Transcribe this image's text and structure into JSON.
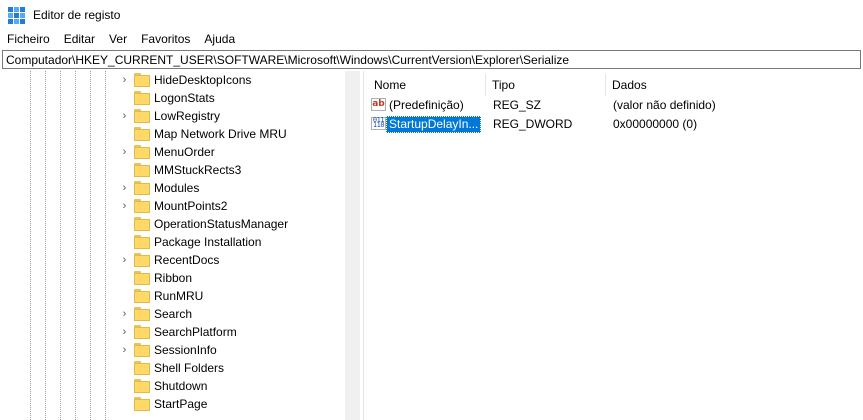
{
  "window": {
    "title": "Editor de registo"
  },
  "menubar": {
    "items": [
      "Ficheiro",
      "Editar",
      "Ver",
      "Favoritos",
      "Ajuda"
    ]
  },
  "address": {
    "path": "Computador\\HKEY_CURRENT_USER\\SOFTWARE\\Microsoft\\Windows\\CurrentVersion\\Explorer\\Serialize"
  },
  "tree": {
    "items": [
      {
        "label": "HideDesktopIcons",
        "expandable": true
      },
      {
        "label": "LogonStats",
        "expandable": false
      },
      {
        "label": "LowRegistry",
        "expandable": true
      },
      {
        "label": "Map Network Drive MRU",
        "expandable": false
      },
      {
        "label": "MenuOrder",
        "expandable": true
      },
      {
        "label": "MMStuckRects3",
        "expandable": false
      },
      {
        "label": "Modules",
        "expandable": true
      },
      {
        "label": "MountPoints2",
        "expandable": true
      },
      {
        "label": "OperationStatusManager",
        "expandable": false
      },
      {
        "label": "Package Installation",
        "expandable": false
      },
      {
        "label": "RecentDocs",
        "expandable": true
      },
      {
        "label": "Ribbon",
        "expandable": false
      },
      {
        "label": "RunMRU",
        "expandable": false
      },
      {
        "label": "Search",
        "expandable": true
      },
      {
        "label": "SearchPlatform",
        "expandable": true
      },
      {
        "label": "SessionInfo",
        "expandable": true
      },
      {
        "label": "Shell Folders",
        "expandable": false
      },
      {
        "label": "Shutdown",
        "expandable": false
      },
      {
        "label": "StartPage",
        "expandable": false
      }
    ]
  },
  "list": {
    "columns": {
      "name": "Nome",
      "type": "Tipo",
      "data": "Dados"
    },
    "rows": [
      {
        "name": "(Predefinição)",
        "type": "REG_SZ",
        "data": "(valor não definido)",
        "icon": "string-value-icon",
        "selected": false
      },
      {
        "name": "StartupDelayIn...",
        "type": "REG_DWORD",
        "data": "0x00000000 (0)",
        "icon": "dword-value-icon",
        "selected": true
      }
    ]
  },
  "colors": {
    "selection": "#0078d7",
    "folder": "#ffd968"
  }
}
